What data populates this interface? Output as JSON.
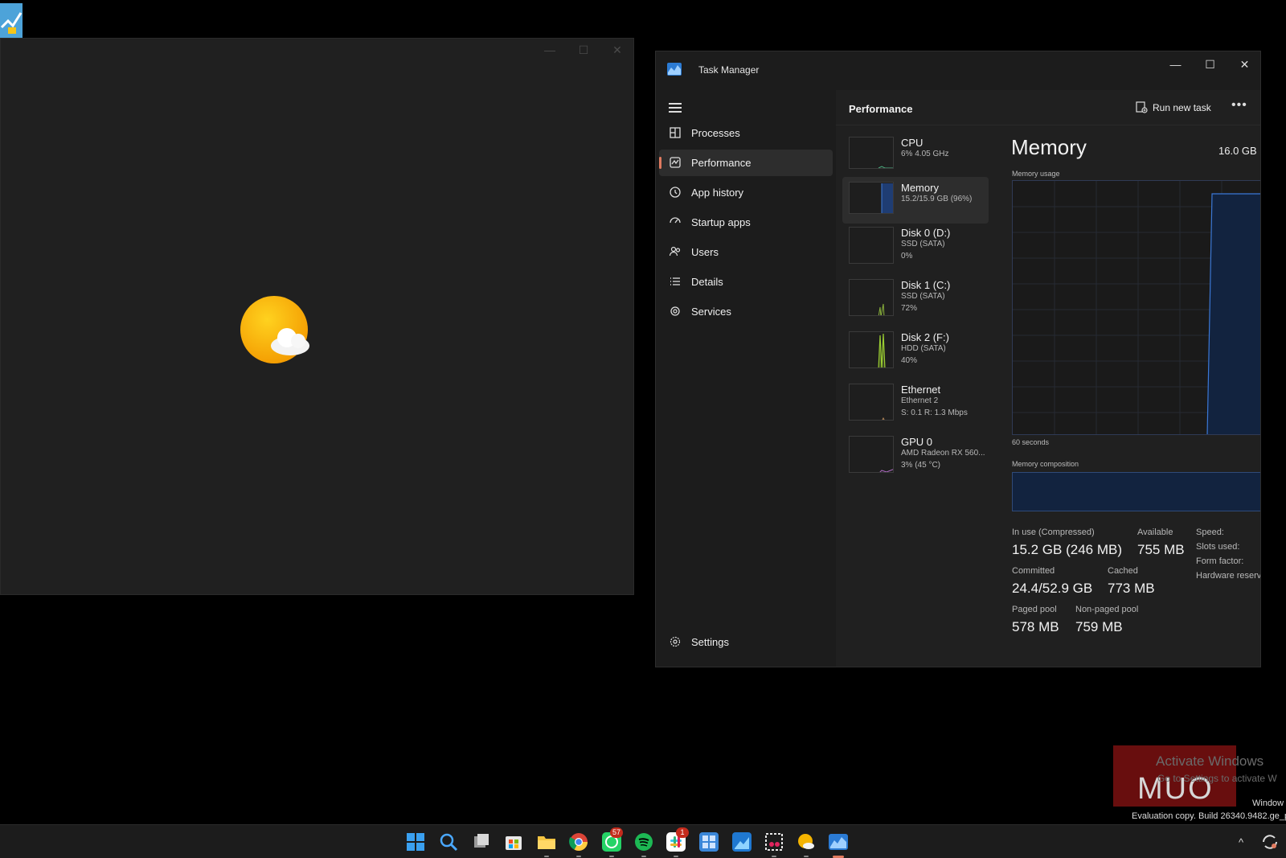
{
  "weather_window": {
    "controls": {
      "minimize": "—",
      "maximize": "☐",
      "close": "✕"
    }
  },
  "task_manager": {
    "title": "Task Manager",
    "controls": {
      "minimize": "—",
      "maximize": "☐",
      "close": "✕"
    },
    "nav": {
      "items": [
        {
          "label": "Processes",
          "icon": "processes-icon"
        },
        {
          "label": "Performance",
          "icon": "performance-icon",
          "active": true
        },
        {
          "label": "App history",
          "icon": "history-icon"
        },
        {
          "label": "Startup apps",
          "icon": "startup-icon"
        },
        {
          "label": "Users",
          "icon": "users-icon"
        },
        {
          "label": "Details",
          "icon": "details-icon"
        },
        {
          "label": "Services",
          "icon": "services-icon"
        }
      ],
      "settings": "Settings"
    },
    "header": {
      "title": "Performance",
      "run_new_task": "Run new task",
      "more": "•••"
    },
    "perf_list": [
      {
        "name": "CPU",
        "sub1": "6% 4.05 GHz",
        "sub2": ""
      },
      {
        "name": "Memory",
        "sub1": "15.2/15.9 GB (96%)",
        "sub2": "",
        "selected": true
      },
      {
        "name": "Disk 0 (D:)",
        "sub1": "SSD (SATA)",
        "sub2": "0%"
      },
      {
        "name": "Disk 1 (C:)",
        "sub1": "SSD (SATA)",
        "sub2": "72%"
      },
      {
        "name": "Disk 2 (F:)",
        "sub1": "HDD (SATA)",
        "sub2": "40%"
      },
      {
        "name": "Ethernet",
        "sub1": "Ethernet 2",
        "sub2": "S: 0.1 R: 1.3 Mbps"
      },
      {
        "name": "GPU 0",
        "sub1": "AMD Radeon RX 560...",
        "sub2": "3% (45 °C)"
      }
    ],
    "detail": {
      "title": "Memory",
      "total": "16.0 GB",
      "usage_label": "Memory usage",
      "seconds_label": "60 seconds",
      "composition_label": "Memory composition",
      "stats": {
        "in_use_label": "In use (Compressed)",
        "in_use_value": "15.2 GB (246 MB)",
        "available_label": "Available",
        "available_value": "755 MB",
        "committed_label": "Committed",
        "committed_value": "24.4/52.9 GB",
        "cached_label": "Cached",
        "cached_value": "773 MB",
        "paged_label": "Paged pool",
        "paged_value": "578 MB",
        "nonpaged_label": "Non-paged pool",
        "nonpaged_value": "759 MB",
        "speed_label": "Speed:",
        "slots_label": "Slots used:",
        "form_label": "Form factor:",
        "hw_label": "Hardware reserv"
      }
    }
  },
  "watermark": {
    "logo": "MUO",
    "activate_title": "Activate Windows",
    "activate_sub": "Go to Settings to activate W",
    "eval_line1": "Window",
    "eval_line2": "Evaluation copy. Build 26340.9482.ge_p"
  },
  "taskbar": {
    "whatsapp_badge": "57",
    "slack_badge": "1"
  },
  "colors": {
    "accent": "#e07a5f",
    "memory_graph": "#2b5aa8",
    "memory_fill": "#12233f"
  }
}
